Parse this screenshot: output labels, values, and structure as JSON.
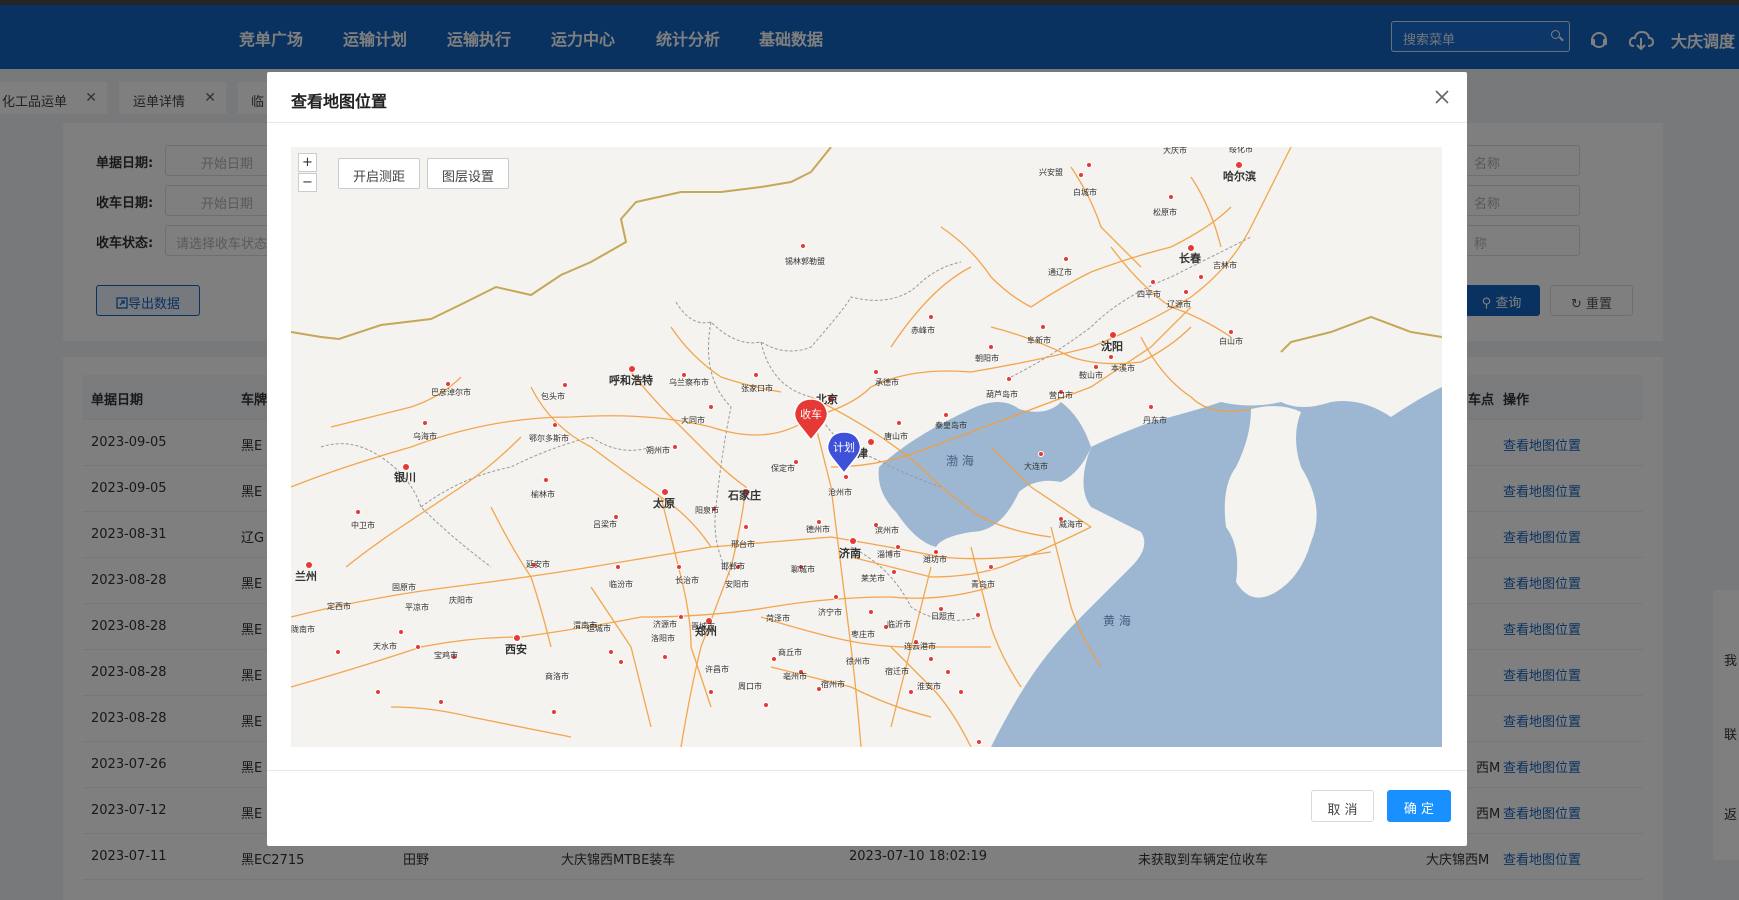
{
  "nav": {
    "items": [
      "竞单广场",
      "运输计划",
      "运输执行",
      "运力中心",
      "统计分析",
      "基础数据"
    ],
    "search_placeholder": "搜索菜单",
    "company": "大庆调度"
  },
  "tabs": [
    {
      "label": "化工品运单"
    },
    {
      "label": "运单详情"
    },
    {
      "label": "临"
    }
  ],
  "filter": {
    "date_label": "单据日期:",
    "date_placeholder": "开始日期",
    "receive_date_label": "收车日期:",
    "receive_date_placeholder": "开始日期",
    "status_label": "收车状态:",
    "status_placeholder": "请选择收车状态",
    "right_placeholder_1": "名称",
    "right_placeholder_2": "名称",
    "right_placeholder_3": "称",
    "export_label": "导出数据",
    "query_label": "查询",
    "reset_label": "重置"
  },
  "table": {
    "headers": [
      "单据日期",
      "车牌",
      "车点",
      "操作"
    ],
    "rows": [
      {
        "date": "2023-09-05",
        "plate": "黑E",
        "action": "查看地图位置"
      },
      {
        "date": "2023-09-05",
        "plate": "黑E",
        "action": "查看地图位置"
      },
      {
        "date": "2023-08-31",
        "plate": "辽G",
        "action": "查看地图位置"
      },
      {
        "date": "2023-08-28",
        "plate": "黑E",
        "action": "查看地图位置"
      },
      {
        "date": "2023-08-28",
        "plate": "黑E",
        "action": "查看地图位置"
      },
      {
        "date": "2023-08-28",
        "plate": "黑E",
        "action": "查看地图位置"
      },
      {
        "date": "2023-08-28",
        "plate": "黑E",
        "action": "查看地图位置"
      },
      {
        "date": "2023-07-26",
        "plate": "黑E",
        "station": "西M",
        "action": "查看地图位置"
      },
      {
        "date": "2023-07-12",
        "plate": "黑E",
        "station": "西M",
        "action": "查看地图位置"
      },
      {
        "date": "2023-07-11",
        "plate": "黑EC2715",
        "driver": "田野",
        "place": "大庆锦西MTBE装车",
        "time": "2023-07-10 18:02:19",
        "status": "未获取到车辆定位收车",
        "station": "大庆锦西M",
        "action": "查看地图位置"
      }
    ]
  },
  "side_panel": {
    "labels": [
      "我",
      "联",
      "返"
    ]
  },
  "modal": {
    "title": "查看地图位置",
    "zoom_in": "+",
    "zoom_out": "−",
    "measure_label": "开启测距",
    "layer_label": "图层设置",
    "cancel_label": "取 消",
    "confirm_label": "确 定",
    "markers": {
      "receive": "收车",
      "plan": "计划"
    },
    "cities": [
      {
        "name": "北京",
        "major": true
      },
      {
        "name": "天津",
        "major": true
      },
      {
        "name": "石家庄",
        "major": true
      },
      {
        "name": "太原",
        "major": true
      },
      {
        "name": "济南",
        "major": true
      },
      {
        "name": "郑州",
        "major": true
      },
      {
        "name": "西安",
        "major": true
      },
      {
        "name": "银川",
        "major": true
      },
      {
        "name": "兰州",
        "major": true
      },
      {
        "name": "呼和浩特",
        "major": true
      },
      {
        "name": "沈阳",
        "major": true
      },
      {
        "name": "长春",
        "major": true
      },
      {
        "name": "哈尔滨",
        "major": true
      },
      {
        "name": "锡林郭勒盟",
        "major": false
      },
      {
        "name": "包头市",
        "major": false
      },
      {
        "name": "巴彦淖尔市",
        "major": false
      },
      {
        "name": "乌海市",
        "major": false
      },
      {
        "name": "鄂尔多斯市",
        "major": false
      },
      {
        "name": "乌兰察布市",
        "major": false
      },
      {
        "name": "张家口市",
        "major": false
      },
      {
        "name": "承德市",
        "major": false
      },
      {
        "name": "大同市",
        "major": false
      },
      {
        "name": "朔州市",
        "major": false
      },
      {
        "name": "保定市",
        "major": false
      },
      {
        "name": "沧州市",
        "major": false
      },
      {
        "name": "唐山市",
        "major": false
      },
      {
        "name": "秦皇岛市",
        "major": false
      },
      {
        "name": "赤峰市",
        "major": false
      },
      {
        "name": "朝阳市",
        "major": false
      },
      {
        "name": "葫芦岛市",
        "major": false
      },
      {
        "name": "阜新市",
        "major": false
      },
      {
        "name": "营口市",
        "major": false
      },
      {
        "name": "鞍山市",
        "major": false
      },
      {
        "name": "本溪市",
        "major": false
      },
      {
        "name": "丹东市",
        "major": false
      },
      {
        "name": "大连市",
        "major": false
      },
      {
        "name": "通辽市",
        "major": false
      },
      {
        "name": "四平市",
        "major": false
      },
      {
        "name": "辽源市",
        "major": false
      },
      {
        "name": "吉林市",
        "major": false
      },
      {
        "name": "松原市",
        "major": false
      },
      {
        "name": "白城市",
        "major": false
      },
      {
        "name": "兴安盟",
        "major": false
      },
      {
        "name": "大庆市",
        "major": false
      },
      {
        "name": "绥化市",
        "major": false
      },
      {
        "name": "白山市",
        "major": false
      },
      {
        "name": "榆林市",
        "major": false
      },
      {
        "name": "吕梁市",
        "major": false
      },
      {
        "name": "阳泉市",
        "major": false
      },
      {
        "name": "长治市",
        "major": false
      },
      {
        "name": "晋城市",
        "major": false
      },
      {
        "name": "临汾市",
        "major": false
      },
      {
        "name": "运城市",
        "major": false
      },
      {
        "name": "邢台市",
        "major": false
      },
      {
        "name": "邯郸市",
        "major": false
      },
      {
        "name": "安阳市",
        "major": false
      },
      {
        "name": "聊城市",
        "major": false
      },
      {
        "name": "德州市",
        "major": false
      },
      {
        "name": "滨州市",
        "major": false
      },
      {
        "name": "淄博市",
        "major": false
      },
      {
        "name": "潍坊市",
        "major": false
      },
      {
        "name": "青岛市",
        "major": false
      },
      {
        "name": "威海市",
        "major": false
      },
      {
        "name": "莱芜市",
        "major": false
      },
      {
        "name": "济宁市",
        "major": false
      },
      {
        "name": "临沂市",
        "major": false
      },
      {
        "name": "日照市",
        "major": false
      },
      {
        "name": "枣庄市",
        "major": false
      },
      {
        "name": "连云港市",
        "major": false
      },
      {
        "name": "徐州市",
        "major": false
      },
      {
        "name": "宿迁市",
        "major": false
      },
      {
        "name": "淮安市",
        "major": false
      },
      {
        "name": "宿州市",
        "major": false
      },
      {
        "name": "亳州市",
        "major": false
      },
      {
        "name": "商丘市",
        "major": false
      },
      {
        "name": "菏泽市",
        "major": false
      },
      {
        "name": "周口市",
        "major": false
      },
      {
        "name": "许昌市",
        "major": false
      },
      {
        "name": "洛阳市",
        "major": false
      },
      {
        "name": "济源市",
        "major": false
      },
      {
        "name": "渭南市",
        "major": false
      },
      {
        "name": "延安市",
        "major": false
      },
      {
        "name": "商洛市",
        "major": false
      },
      {
        "name": "宝鸡市",
        "major": false
      },
      {
        "name": "天水市",
        "major": false
      },
      {
        "name": "平凉市",
        "major": false
      },
      {
        "name": "庆阳市",
        "major": false
      },
      {
        "name": "固原市",
        "major": false
      },
      {
        "name": "定西市",
        "major": false
      },
      {
        "name": "中卫市",
        "major": false
      },
      {
        "name": "陇南市",
        "major": false
      }
    ],
    "seas": [
      "渤 海",
      "黄 海"
    ]
  }
}
